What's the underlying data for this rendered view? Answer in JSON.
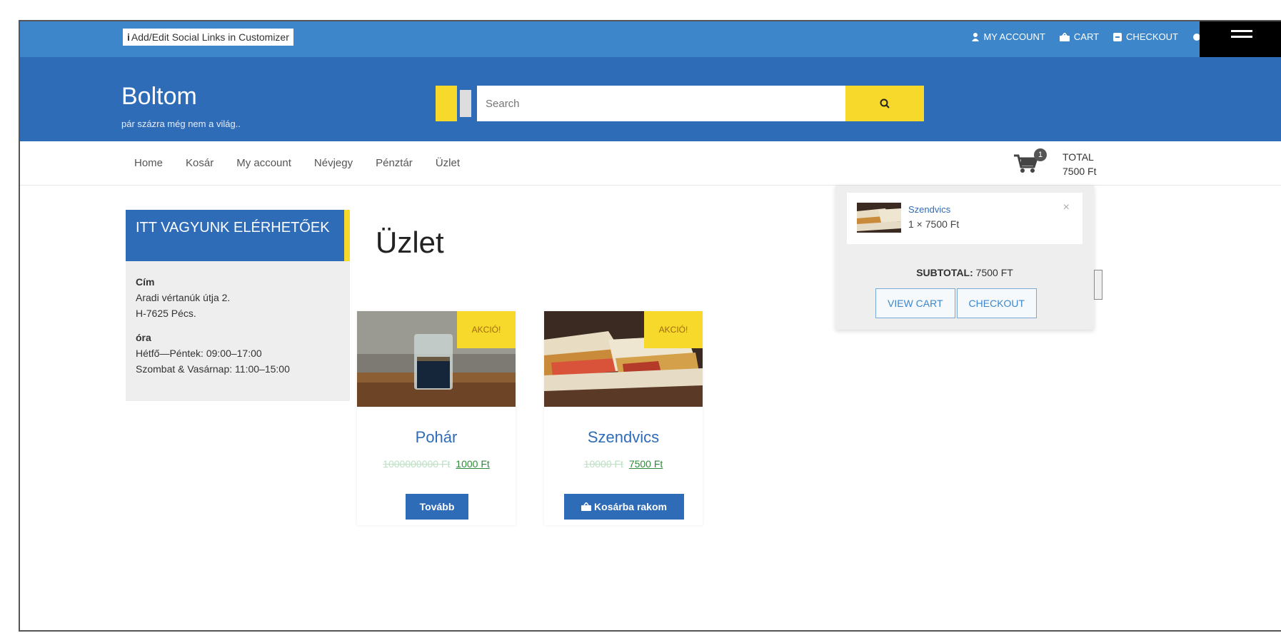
{
  "topbar": {
    "social_link": "Add/Edit Social Links in Customizer",
    "social_icon": "info-icon",
    "links": [
      {
        "label": "MY ACCOUNT",
        "icon": "user-icon"
      },
      {
        "label": "CART",
        "icon": "basket-icon"
      },
      {
        "label": "CHECKOUT",
        "icon": "checkout-icon"
      }
    ]
  },
  "header": {
    "site_title": "Boltom",
    "tagline": "pár százra még nem a világ..",
    "search_placeholder": "Search"
  },
  "nav": {
    "items": [
      "Home",
      "Kosár",
      "My account",
      "Névjegy",
      "Pénztár",
      "Üzlet"
    ],
    "cart_count": "1",
    "total_label": "TOTAL",
    "total_value": "7500 Ft"
  },
  "widget": {
    "title": "ITT VAGYUNK ELÉRHETŐEK",
    "address_label": "Cím",
    "address_line1": "Aradi vértanúk útja 2.",
    "address_line2": "H-7625 Pécs.",
    "hours_label": "óra",
    "hours_line1": "Hétfő—Péntek: 09:00–17:00",
    "hours_line2": "Szombat & Vasárnap: 11:00–15:00"
  },
  "main": {
    "page_title": "Üzlet",
    "products": [
      {
        "name": "Pohár",
        "badge": "AKCIÓ!",
        "old_price": "1000000000 Ft",
        "new_price": "1000 Ft",
        "action": "Tovább"
      },
      {
        "name": "Szendvics",
        "badge": "AKCIÓ!",
        "old_price": "10000 Ft",
        "new_price": "7500 Ft",
        "action": "Kosárba rakom"
      }
    ]
  },
  "mini_cart": {
    "item_name": "Szendvics",
    "item_qty": "1 × 7500 Ft",
    "remove": "×",
    "subtotal_label": "SUBTOTAL:",
    "subtotal_value": "7500 FT",
    "view_cart": "VIEW CART",
    "checkout": "CHECKOUT"
  },
  "colors": {
    "topbar": "#3d86c9",
    "header": "#2f6cb8",
    "accent": "#f6d92a",
    "price_new": "#2e8b3a"
  }
}
